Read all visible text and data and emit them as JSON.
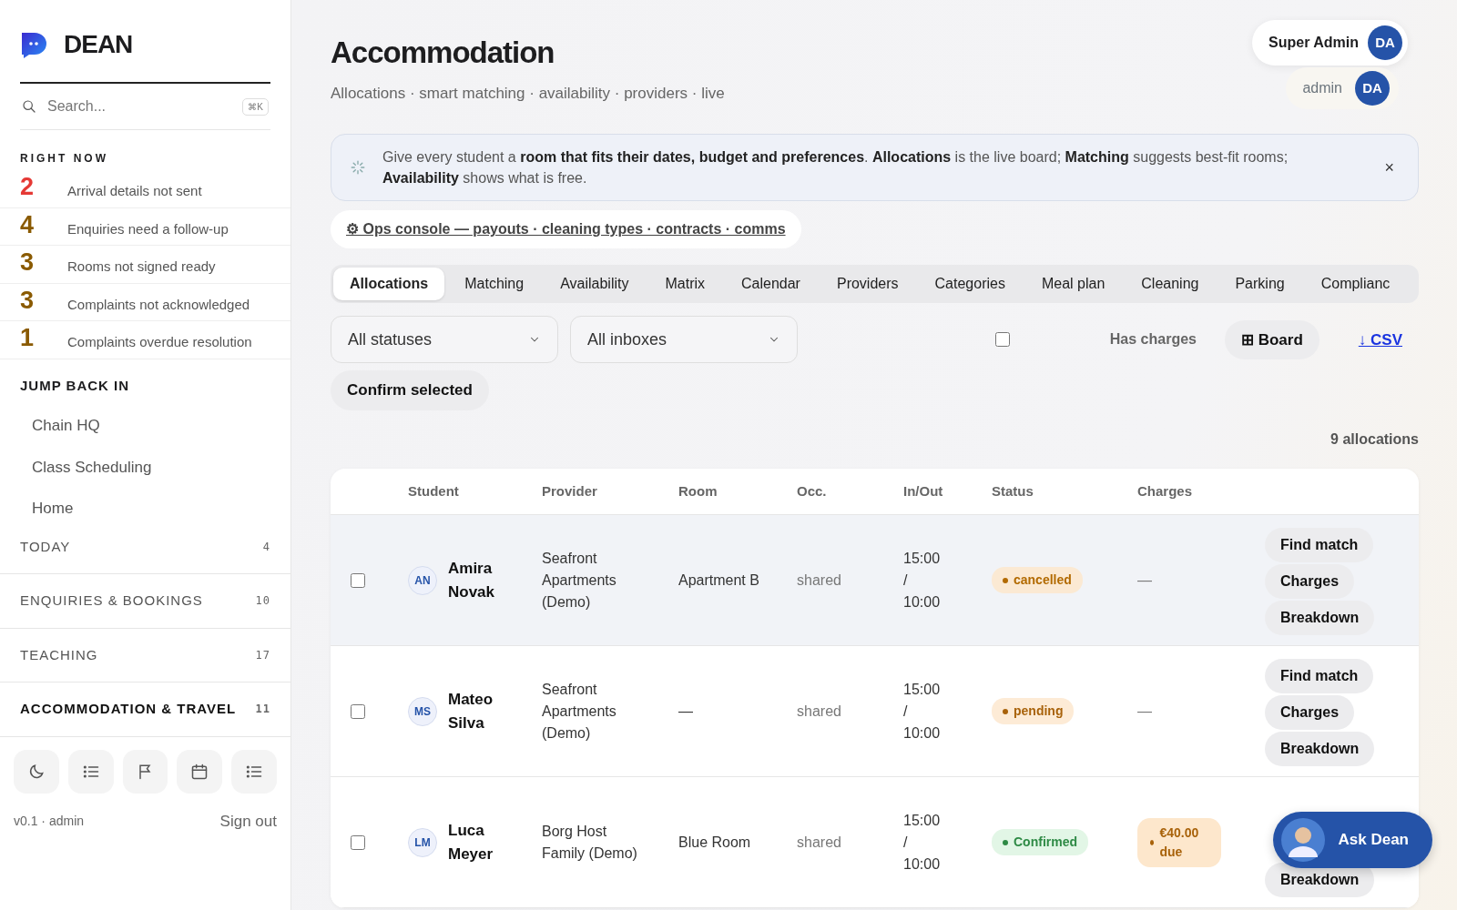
{
  "brand": {
    "name": "DEAN"
  },
  "search": {
    "placeholder": "Search...",
    "shortcut": "⌘K"
  },
  "right_now": {
    "title": "RIGHT NOW",
    "items": [
      {
        "count": "2",
        "label": "Arrival details not sent",
        "urgent": true
      },
      {
        "count": "4",
        "label": "Enquiries need a follow-up",
        "urgent": false
      },
      {
        "count": "3",
        "label": "Rooms not signed ready",
        "urgent": false
      },
      {
        "count": "3",
        "label": "Complaints not acknowledged",
        "urgent": false
      },
      {
        "count": "1",
        "label": "Complaints overdue resolution",
        "urgent": false
      }
    ]
  },
  "jump_back_in": {
    "title": "JUMP BACK IN",
    "items": [
      "Chain HQ",
      "Class Scheduling",
      "Home"
    ]
  },
  "sections": [
    {
      "label": "TODAY",
      "count": "4",
      "selected": false
    },
    {
      "label": "ENQUIRIES & BOOKINGS",
      "count": "10",
      "selected": false
    },
    {
      "label": "TEACHING",
      "count": "17",
      "selected": false
    },
    {
      "label": "ACCOMMODATION & TRAVEL",
      "count": "11",
      "selected": true
    }
  ],
  "toolbar": [
    {
      "kind": "moon"
    },
    {
      "kind": "list"
    },
    {
      "kind": "flag"
    },
    {
      "kind": "calendar"
    },
    {
      "kind": "list"
    }
  ],
  "footer": {
    "version": "v0.1 · admin",
    "sign_out": "Sign out"
  },
  "user": {
    "role": "Super Admin",
    "name": "admin",
    "initials": "DA",
    "initials_2": "DA"
  },
  "page": {
    "title": "Accommodation",
    "subtitle": "Allocations · smart matching · availability · providers · live"
  },
  "banner": {
    "text": "Give every student a **room that fits their dates, budget and preferences**. **Allocations** is the live board; **Matching** suggests best-fit rooms; **Availability** shows what is free.",
    "close": "×"
  },
  "ops_link": "⚙ Ops console — payouts · cleaning types · contracts · comms",
  "tabs": [
    {
      "label": "Allocations",
      "selected": true
    },
    {
      "label": "Matching",
      "selected": false
    },
    {
      "label": "Availability",
      "selected": false
    },
    {
      "label": "Matrix",
      "selected": false
    },
    {
      "label": "Calendar",
      "selected": false
    },
    {
      "label": "Providers",
      "selected": false
    },
    {
      "label": "Categories",
      "selected": false
    },
    {
      "label": "Meal plan",
      "selected": false
    },
    {
      "label": "Cleaning",
      "selected": false
    },
    {
      "label": "Parking",
      "selected": false
    },
    {
      "label": "Complianc",
      "selected": false
    }
  ],
  "filters": {
    "status": "All statuses",
    "inbox": "All inboxes",
    "has_charges": {
      "label": "Has charges",
      "checked": false
    },
    "board": "⊞ Board",
    "csv": "↓ CSV",
    "confirm": "Confirm selected"
  },
  "count_label": "9 allocations",
  "table": {
    "columns": [
      "Student",
      "Provider",
      "Room",
      "Occ.",
      "In/Out",
      "Status",
      "Charges"
    ],
    "rows": [
      {
        "selected": false,
        "highlighted": true,
        "initials": "AN",
        "student": "Amira Novak",
        "provider": "Seafront Apartments (Demo)",
        "room": "Apartment B",
        "occ": "shared",
        "in_out": "15:00 / 10:00",
        "status": {
          "label": "cancelled",
          "kind": "cancelled"
        },
        "charges": {
          "label": "—",
          "kind": "none"
        },
        "actions": [
          "Find match",
          "Charges",
          "Breakdown"
        ]
      },
      {
        "selected": false,
        "highlighted": false,
        "initials": "MS",
        "student": "Mateo Silva",
        "provider": "Seafront Apartments (Demo)",
        "room": "—",
        "occ": "shared",
        "in_out": "15:00 / 10:00",
        "status": {
          "label": "pending",
          "kind": "pending"
        },
        "charges": {
          "label": "—",
          "kind": "none"
        },
        "actions": [
          "Find match",
          "Charges",
          "Breakdown"
        ]
      },
      {
        "selected": false,
        "highlighted": false,
        "initials": "LM",
        "student": "Luca Meyer",
        "provider": "Borg Host Family (Demo)",
        "room": "Blue Room",
        "occ": "shared",
        "in_out": "15:00 / 10:00",
        "status": {
          "label": "Confirmed",
          "kind": "confirmed"
        },
        "charges": {
          "label": "€40.00 due",
          "kind": "due"
        },
        "actions": [
          "Breakdown"
        ]
      }
    ]
  },
  "assistant": {
    "label": "Ask Dean"
  }
}
